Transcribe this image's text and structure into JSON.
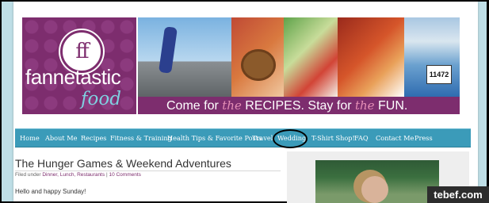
{
  "brand": {
    "logo_monogram": "ff",
    "name_line1": "fannetastic",
    "name_line2": "food",
    "bib_number": "11472"
  },
  "tagline": {
    "part1": "Come for ",
    "em1": "the",
    "part2": " RECIPES. Stay for ",
    "em2": "the",
    "part3": " FUN."
  },
  "nav": {
    "items": [
      {
        "label": "Home"
      },
      {
        "label": "About Me"
      },
      {
        "label": "Recipes"
      },
      {
        "label": "Fitness & Training"
      },
      {
        "label": "Health Tips & Favorite Posts"
      },
      {
        "label": "Travel"
      },
      {
        "label": "Wedding"
      },
      {
        "label": "T-Shirt Shop!"
      },
      {
        "label": "FAQ"
      },
      {
        "label": "Contact Me"
      },
      {
        "label": "Press"
      }
    ],
    "highlighted": "Wedding"
  },
  "post": {
    "title": "The Hunger Games & Weekend Adventures",
    "filed_under_label": "Filed under",
    "categories": "Dinner, Lunch, Restaurants",
    "separator": "|",
    "comments": "10 Comments",
    "intro": "Hello and happy Sunday!"
  },
  "watermark": "tebef.com",
  "colors": {
    "brand_purple": "#7d2d6e",
    "nav_teal": "#3b9bb9",
    "outer_bg": "#bfdfe7",
    "tagline_accent": "#e58fb6"
  }
}
